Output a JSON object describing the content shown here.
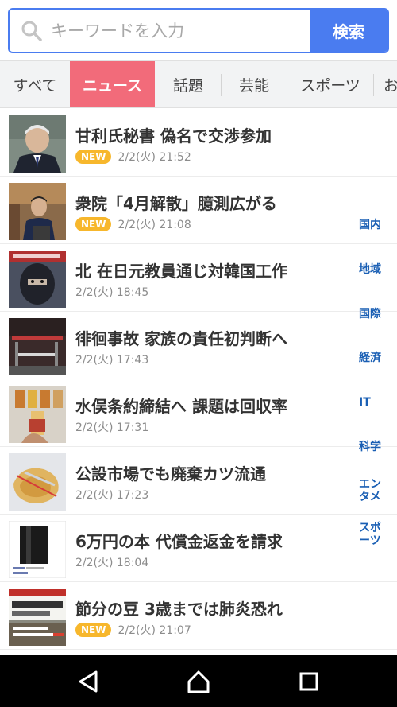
{
  "search": {
    "placeholder": "キーワードを入力",
    "button_label": "検索"
  },
  "tabs": [
    {
      "label": "すべて",
      "active": false
    },
    {
      "label": "ニュース",
      "active": true
    },
    {
      "label": "話題",
      "active": false
    },
    {
      "label": "芸能",
      "active": false
    },
    {
      "label": "スポーツ",
      "active": false
    },
    {
      "label": "お",
      "active": false
    }
  ],
  "news": [
    {
      "title": "甘利氏秘書 偽名で交渉参加",
      "time": "2/2(火) 21:52",
      "is_new": true,
      "badge": "NEW",
      "thumb": "man-in-suit"
    },
    {
      "title": "衆院「4月解散」臆測広がる",
      "time": "2/2(火) 21:08",
      "is_new": true,
      "badge": "NEW",
      "thumb": "politician-podium"
    },
    {
      "title": "北 在日元教員通じ対韓国工作",
      "time": "2/2(火) 18:45",
      "is_new": false,
      "badge": "",
      "thumb": "masked-person"
    },
    {
      "title": "徘徊事故 家族の責任初判断へ",
      "time": "2/2(火) 17:43",
      "is_new": false,
      "badge": "",
      "thumb": "train-crossing"
    },
    {
      "title": "水俣条約締結へ 課題は回収率",
      "time": "2/2(火) 17:31",
      "is_new": false,
      "badge": "",
      "thumb": "battery-bottles"
    },
    {
      "title": "公設市場でも廃棄カツ流通",
      "time": "2/2(火) 17:23",
      "is_new": false,
      "badge": "",
      "thumb": "fried-cutlet"
    },
    {
      "title": "6万円の本 代償金返金を請求",
      "time": "2/2(火) 18:04",
      "is_new": false,
      "badge": "",
      "thumb": "black-book"
    },
    {
      "title": "節分の豆 3歳までは肺炎恐れ",
      "time": "2/2(火) 21:07",
      "is_new": true,
      "badge": "NEW",
      "thumb": "tv-caption"
    }
  ],
  "side_index": [
    {
      "label": "国内"
    },
    {
      "label": "地域"
    },
    {
      "label": "国際"
    },
    {
      "label": "経済"
    },
    {
      "label": "IT"
    },
    {
      "label": "科学"
    },
    {
      "label": "エンタメ",
      "lines": [
        "エン",
        "タメ"
      ]
    },
    {
      "label": "スポーツ",
      "lines": [
        "スポ",
        "ーツ"
      ]
    }
  ],
  "nav": {
    "back_icon": "back-triangle-icon",
    "home_icon": "home-icon",
    "recents_icon": "recents-square-icon"
  },
  "colors": {
    "accent_blue": "#4a7cf0",
    "active_tab": "#f26b7a",
    "new_badge": "#f7b72c",
    "side_link": "#1a5fb4"
  }
}
